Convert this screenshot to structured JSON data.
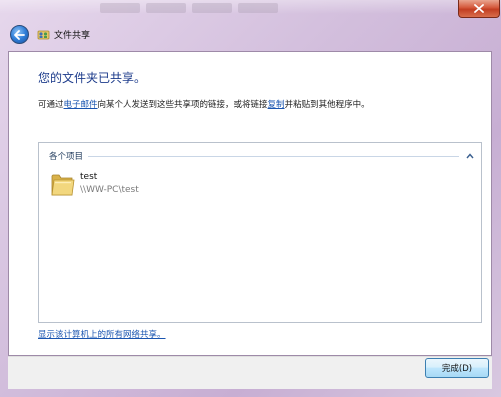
{
  "window": {
    "title": "文件共享",
    "close_icon": "close-icon",
    "back_icon": "back-arrow-icon",
    "accent": "#1c3b8b"
  },
  "content": {
    "heading": "您的文件夹已共享。",
    "desc_part1": "可通过",
    "desc_email_link": "电子邮件",
    "desc_part2": "向某个人发送到这些共享项的链接，或将链接",
    "desc_copy_link": "复制",
    "desc_part3": "并粘贴到其他程序中。"
  },
  "shared_items": {
    "group_label": "各个项目",
    "items": [
      {
        "name": "test",
        "path": "\\\\WW-PC\\test",
        "icon": "folder-icon"
      }
    ]
  },
  "links": {
    "show_all": "显示该计算机上的所有网络共享。"
  },
  "buttons": {
    "finish": "完成(D)"
  }
}
